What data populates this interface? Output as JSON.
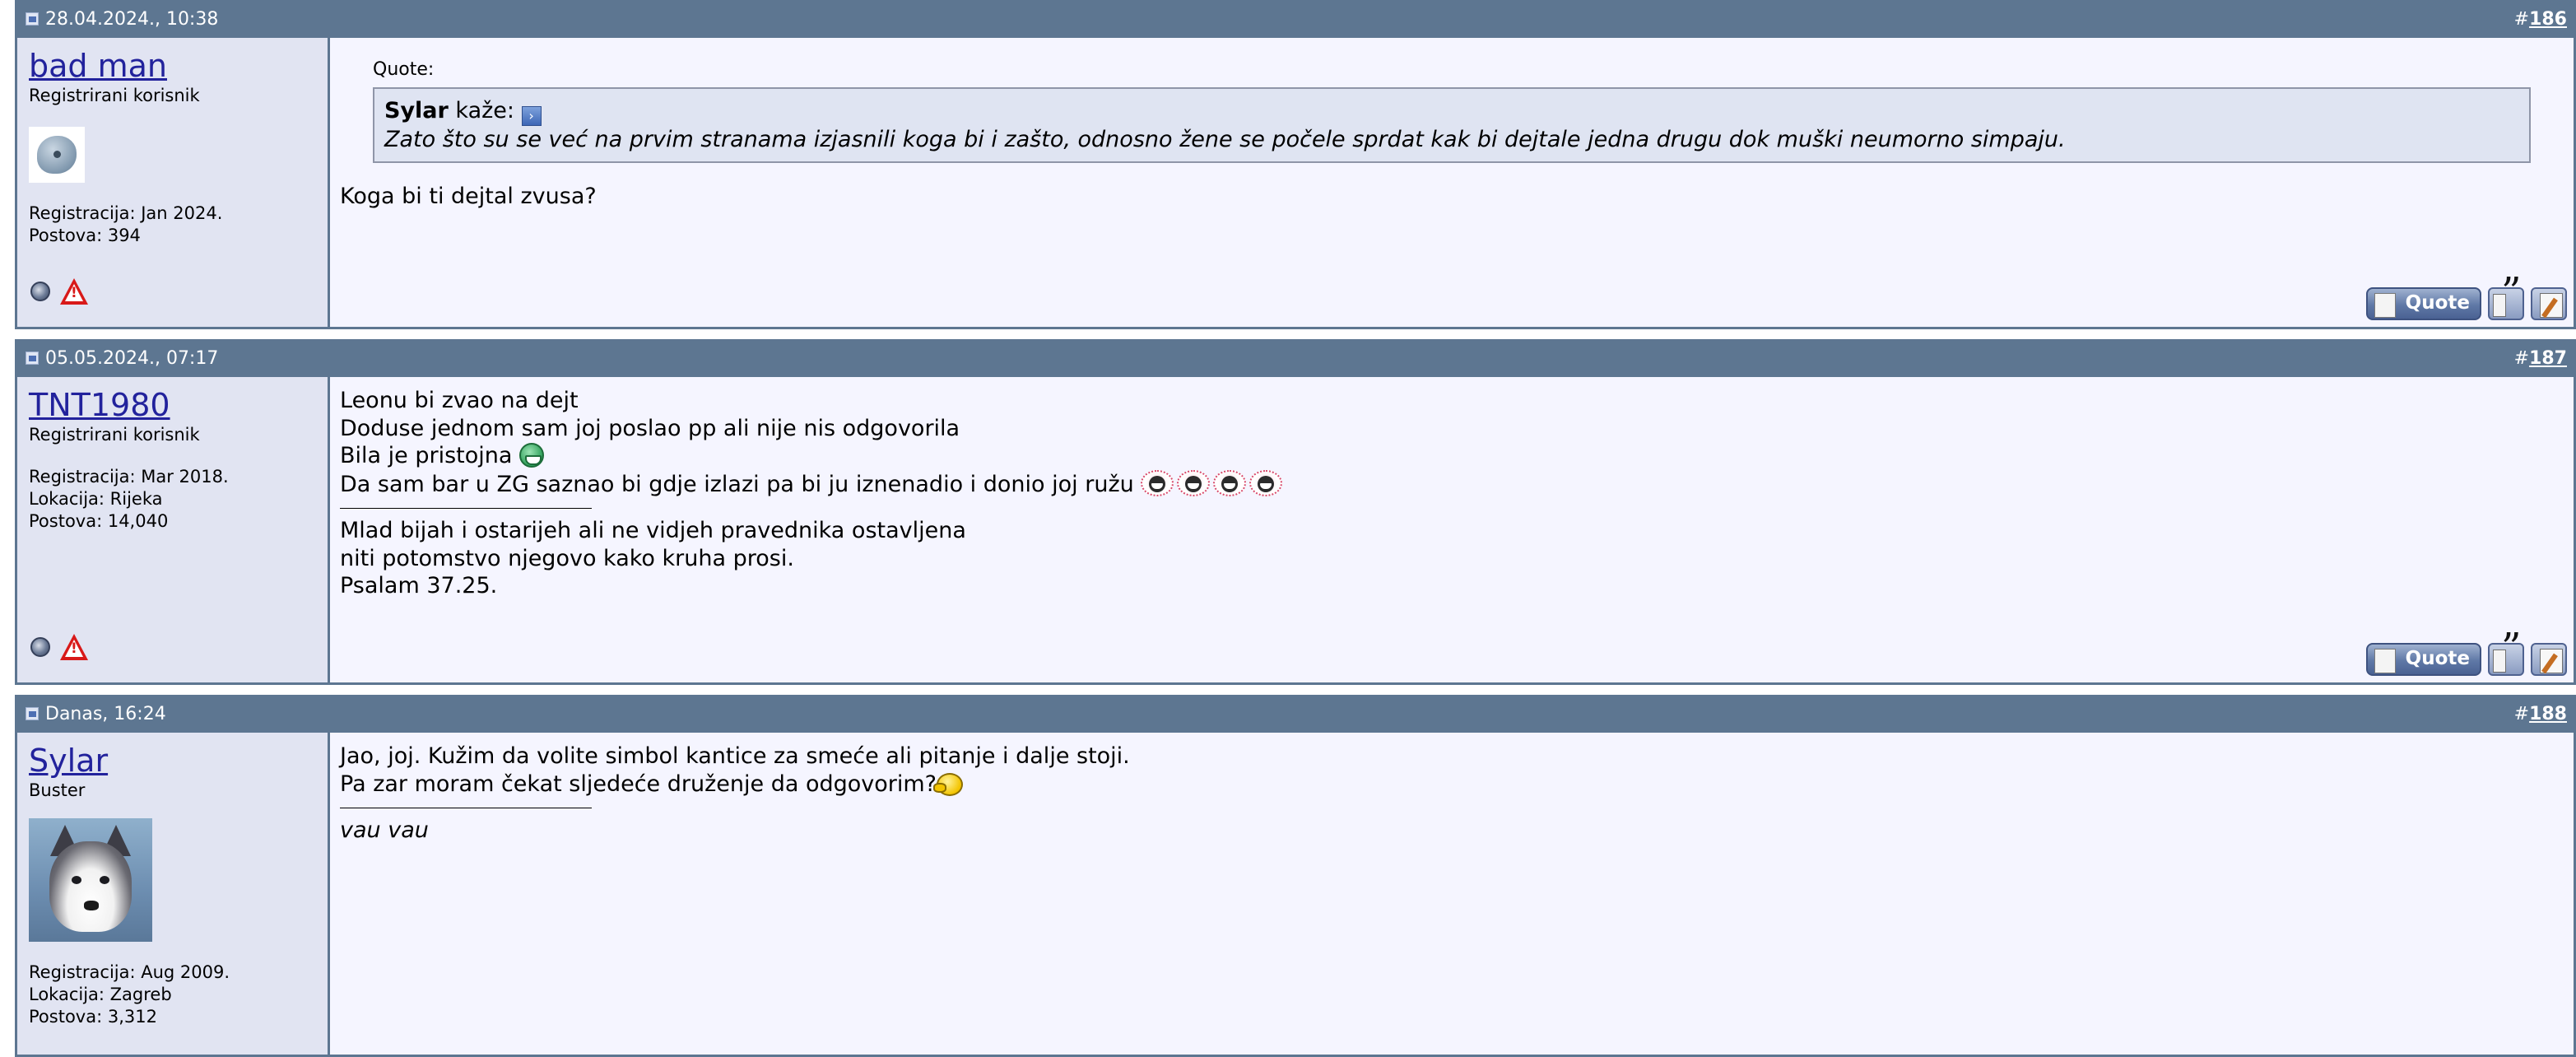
{
  "posts": [
    {
      "date": "28.04.2024., 10:38",
      "number_prefix": "#",
      "number": "186",
      "user": {
        "name": "bad man",
        "title": "Registrirani korisnik",
        "stats": [
          "Registracija: Jan 2024.",
          "Postova: 394"
        ]
      },
      "quote": {
        "label": "Quote:",
        "author": "Sylar",
        "says": " kaže: ",
        "text": "Zato što su se već na prvim stranama izjasnili koga bi i zašto, odnosno žene se počele sprdat kak bi dejtale jedna drugu dok muški neumorno simpaju."
      },
      "lines": [
        "Koga bi ti dejtal zvusa?"
      ],
      "quote_button": "Quote"
    },
    {
      "date": "05.05.2024., 07:17",
      "number_prefix": "#",
      "number": "187",
      "user": {
        "name": "TNT1980",
        "title": "Registrirani korisnik",
        "stats": [
          "Registracija: Mar 2018.",
          "Lokacija: Rijeka",
          "Postova: 14,040"
        ]
      },
      "lines": [
        "Leonu bi zvao na dejt",
        "Doduse jednom sam joj poslao pp ali nije nis odgovorila",
        "Bila je pristojna ",
        "Da sam bar u ZG saznao bi gdje izlazi pa bi ju iznenadio i donio joj ružu "
      ],
      "signature": [
        "Mlad bijah i ostarijeh ali ne vidjeh pravednika ostavljena",
        "niti potomstvo njegovo kako kruha prosi.",
        "Psalam 37.25."
      ],
      "quote_button": "Quote"
    },
    {
      "date": "Danas, 16:24",
      "number_prefix": "#",
      "number": "188",
      "user": {
        "name": "Sylar",
        "title": "Buster",
        "stats": [
          "Registracija: Aug 2009.",
          "Lokacija: Zagreb",
          "Postova: 3,312"
        ]
      },
      "lines": [
        "Jao, joj. Kužim da volite simbol kantice za smeće ali pitanje i dalje stoji.",
        "Pa zar moram čekat sljedeće druženje da odgovorim?"
      ],
      "signature": [
        "vau vau"
      ]
    }
  ],
  "icons": {
    "post": "post-icon",
    "status": "offline-status-icon",
    "report": "report-post-icon",
    "multiquote": "multiquote-icon",
    "quickreply": "quick-reply-icon"
  },
  "colors": {
    "header": "#5d7691",
    "user_column": "#e1e4f2",
    "content": "#f5f5ff",
    "quote_box": "#dfe4f2",
    "username": "#22229c"
  }
}
